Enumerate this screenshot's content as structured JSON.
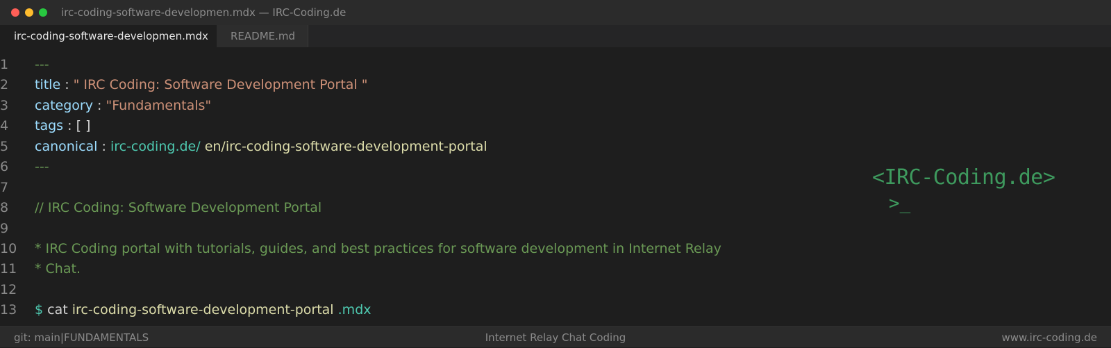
{
  "window": {
    "title": "irc-coding-software-developmen.mdx — IRC-Coding.de"
  },
  "tabs": [
    {
      "label": "irc-coding-software-developmen.mdx",
      "active": true
    },
    {
      "label": "README.md",
      "active": false
    }
  ],
  "editor": {
    "line_numbers": [
      "1",
      "2",
      "3",
      "4",
      "5",
      "6",
      "7",
      "8",
      "9",
      "10",
      "11",
      "12",
      "13"
    ],
    "frontmatter_delim": "---",
    "title_key": "title",
    "title_value": "\" IRC Coding: Software Development Portal \"",
    "category_key": "category",
    "category_value": "\"Fundamentals\"",
    "tags_key": "tags",
    "tags_value": "[ ]",
    "canonical_key": "canonical",
    "canonical_domain": "irc-coding.de/",
    "canonical_path": "en/irc-coding-software-development-portal",
    "colon": ":",
    "comment_line": "// IRC Coding: Software Development Portal",
    "description_line_1": "* IRC Coding portal with tutorials, guides, and best practices for software development in Internet Relay",
    "description_line_2": "* Chat.",
    "prompt_symbol": "$",
    "command": "cat",
    "command_file": "irc-coding-software-development-portal",
    "command_ext": ".mdx"
  },
  "brand": {
    "logo_text": "<IRC-Coding.de>",
    "cursor_text": ">_"
  },
  "status_bar": {
    "branch": "git: main",
    "separator": "|",
    "category": "FUNDAMENTALS",
    "center": "Internet Relay Chat Coding",
    "right": "www.irc-coding.de"
  },
  "colors": {
    "background": "#1e1e1e",
    "key": "#9cdcfe",
    "string": "#ce9178",
    "comment": "#6a9955",
    "accent": "#4ec9b0",
    "brand": "#3e9a5e"
  }
}
